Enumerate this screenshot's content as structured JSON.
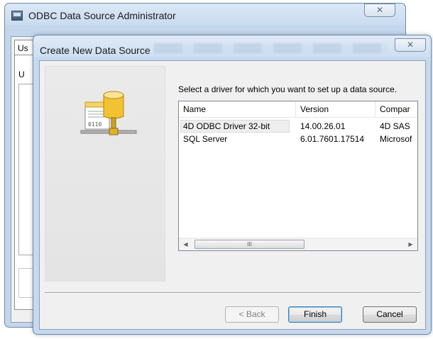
{
  "back_window": {
    "title": "ODBC Data Source Administrator",
    "close_glyph": "✕",
    "tab_fragment": "Us",
    "label_fragment": "U"
  },
  "dialog": {
    "title": "Create New Data Source",
    "close_glyph": "✕",
    "prompt": "Select a driver for which you want to set up a data source.",
    "columns": [
      "Name",
      "Version",
      "Compar"
    ],
    "drivers": [
      {
        "name": "4D ODBC Driver 32-bit",
        "version": "14.00.26.01",
        "company": "4D SAS",
        "selected": true
      },
      {
        "name": "SQL Server",
        "version": "6.01.7601.17514",
        "company": "Microsof",
        "selected": false
      }
    ],
    "scroll": {
      "left": "◀",
      "right": "▶",
      "thumb_grip": "III"
    },
    "buttons": {
      "back": "< Back",
      "finish": "Finish",
      "cancel": "Cancel"
    },
    "icon": "database-with-document-network-icon"
  }
}
